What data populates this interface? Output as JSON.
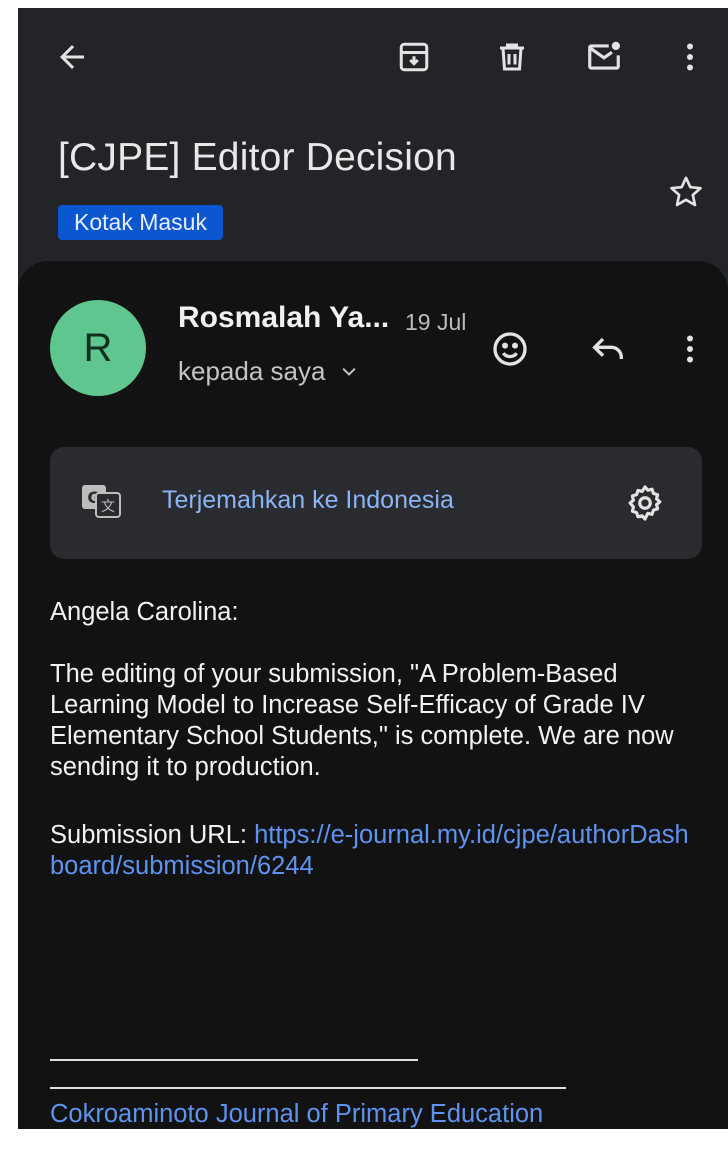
{
  "toolbar": {
    "back": "arrow-back-icon",
    "archive": "archive-icon",
    "delete": "trash-icon",
    "mark_unread": "mark-unread-icon",
    "more": "more-vert-icon"
  },
  "email": {
    "subject": "[CJPE] Editor Decision",
    "label": "Kotak Masuk",
    "sender_initial": "R",
    "sender_name": "Rosmalah Ya...",
    "date": "19 Jul",
    "recipient": "kepada saya"
  },
  "translate": {
    "text": "Terjemahkan ke Indonesia"
  },
  "body": {
    "greeting": "Angela Carolina:",
    "paragraph": "The editing of your submission, \"A Problem-Based Learning Model to Increase Self-Efficacy of Grade IV Elementary School Students,\" is complete. We are now sending it to production.",
    "submission_label": "Submission URL: ",
    "submission_url": "https://e-journal.my.id/cjpe/authorDashboard/submission/6244",
    "signature_journal": "Cokroaminoto Journal of Primary Education"
  },
  "colors": {
    "background": "#232427",
    "card": "#121212",
    "accent_link": "#5e93f0",
    "label_chip": "#0b57d0",
    "avatar": "#5ec68e"
  }
}
